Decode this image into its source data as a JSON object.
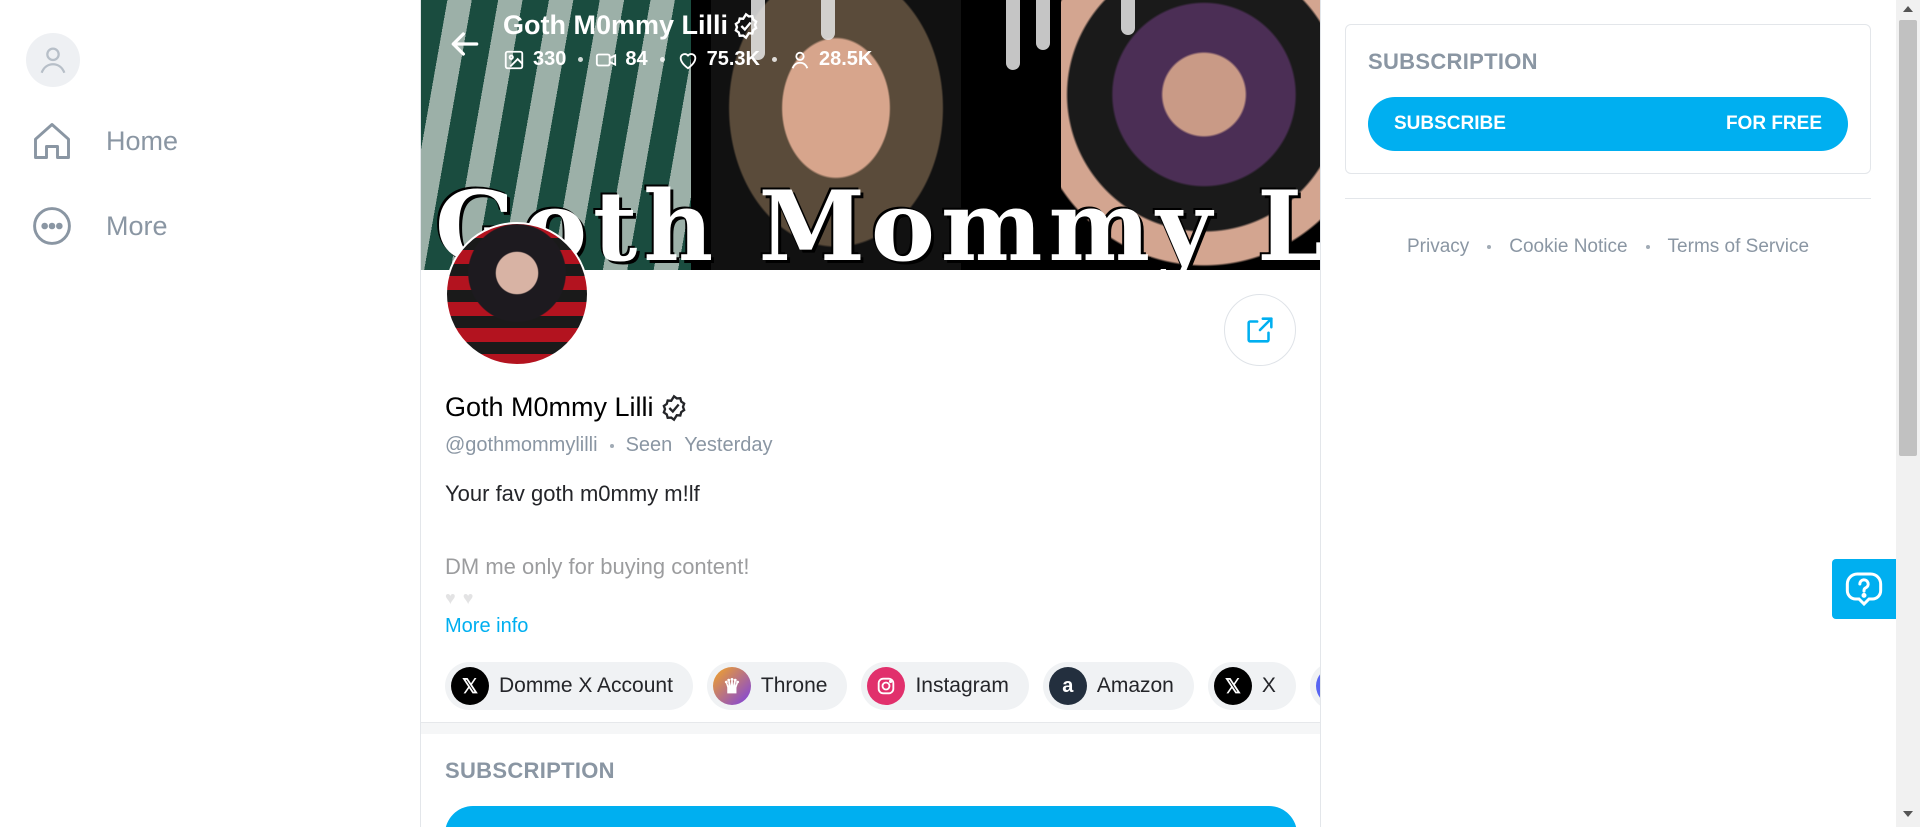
{
  "nav": {
    "items": [
      {
        "label": "Home",
        "icon": "home-icon"
      },
      {
        "label": "More",
        "icon": "more-icon"
      }
    ]
  },
  "banner": {
    "title_art": "Goth Mommy Lilli"
  },
  "header": {
    "name": "Goth M0mmy Lilli",
    "stats": {
      "photos": "330",
      "videos": "84",
      "likes": "75.3K",
      "fans": "28.5K"
    }
  },
  "profile": {
    "name": "Goth M0mmy Lilli",
    "handle": "@gothmommylilli",
    "seen_label": "Seen",
    "seen_value": "Yesterday",
    "bio_line1": "Your fav goth m0mmy m!lf",
    "bio_line2": "DM me only for buying content!",
    "more_info": "More info"
  },
  "links": [
    {
      "label": "Domme X Account",
      "icon": "x-icon",
      "color": "#000000"
    },
    {
      "label": "Throne",
      "icon": "throne-icon",
      "color": "#7b3fe4"
    },
    {
      "label": "Instagram",
      "icon": "instagram-icon",
      "color": "#e1306c"
    },
    {
      "label": "Amazon",
      "icon": "amazon-icon",
      "color": "#232f3e"
    },
    {
      "label": "X",
      "icon": "x-icon",
      "color": "#000000"
    },
    {
      "label": "",
      "icon": "discord-icon",
      "color": "#5865f2"
    }
  ],
  "subscription_center": {
    "label": "SUBSCRIPTION"
  },
  "subscription_card": {
    "title": "SUBSCRIPTION",
    "button_left": "SUBSCRIBE",
    "button_right": "FOR FREE"
  },
  "footer": {
    "privacy": "Privacy",
    "cookie": "Cookie Notice",
    "terms": "Terms of Service"
  },
  "colors": {
    "accent": "#00aff0",
    "muted": "#8a96a3"
  }
}
